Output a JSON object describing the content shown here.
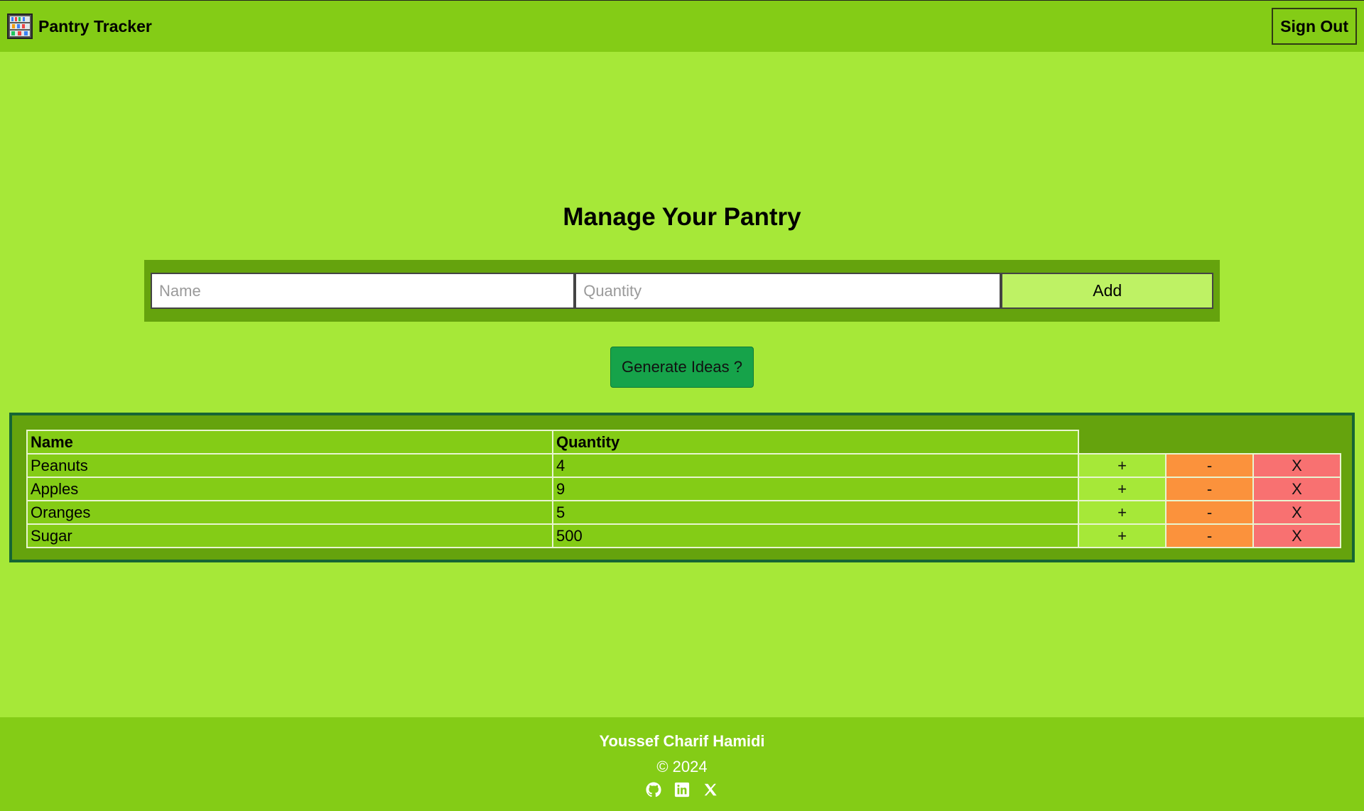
{
  "header": {
    "title": "Pantry Tracker",
    "sign_out_label": "Sign Out",
    "logo_icon": "pantry-shelf-icon"
  },
  "main": {
    "title": "Manage Your Pantry",
    "form": {
      "name_placeholder": "Name",
      "name_value": "",
      "quantity_placeholder": "Quantity",
      "quantity_value": "",
      "add_label": "Add"
    },
    "generate_label": "Generate Ideas ?"
  },
  "table": {
    "headers": [
      "Name",
      "Quantity"
    ],
    "rows": [
      {
        "name": "Peanuts",
        "quantity": "4",
        "plus": "+",
        "minus": "-",
        "delete": "X"
      },
      {
        "name": "Apples",
        "quantity": "9",
        "plus": "+",
        "minus": "-",
        "delete": "X"
      },
      {
        "name": "Oranges",
        "quantity": "5",
        "plus": "+",
        "minus": "-",
        "delete": "X"
      },
      {
        "name": "Sugar",
        "quantity": "500",
        "plus": "+",
        "minus": "-",
        "delete": "X"
      }
    ]
  },
  "footer": {
    "author": "Youssef Charif Hamidi",
    "copyright": "© 2024",
    "icons": [
      "github-icon",
      "linkedin-icon",
      "x-icon"
    ]
  },
  "colors": {
    "page_bg": "#a6e838",
    "header_bg": "#84cc16",
    "panel_bg": "#65a30d",
    "generate_button": "#16a34a",
    "plus_bg": "#a6e838",
    "minus_bg": "#fb923c",
    "delete_bg": "#f87171"
  }
}
